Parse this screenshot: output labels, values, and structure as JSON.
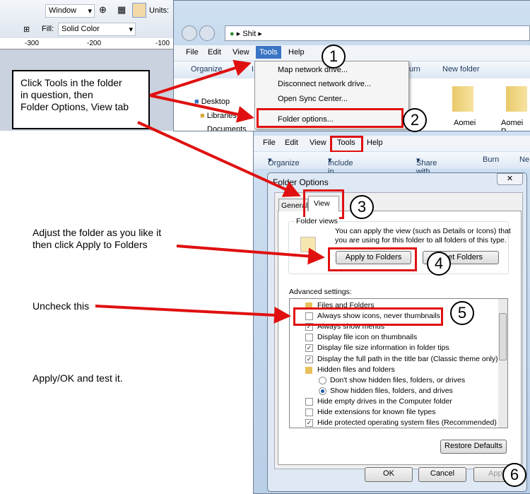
{
  "paint_toolbar": {
    "zoom_select": "Window",
    "units_label": "Units:",
    "fill_label": "Fill:",
    "fill_select": "Solid Color",
    "ruler_ticks": [
      "-300",
      "-200",
      "-100"
    ]
  },
  "explorer_top": {
    "address": "Shit",
    "menu": [
      "File",
      "Edit",
      "View",
      "Tools",
      "Help"
    ],
    "toolbar": [
      "Organize",
      "I",
      "urn",
      "New folder"
    ],
    "nav": [
      "Desktop",
      "Libraries",
      "Documents"
    ],
    "folders": [
      "Aomei",
      "Aomei P"
    ],
    "tools_menu": [
      "Map network drive...",
      "Disconnect network drive...",
      "Open Sync Center...",
      "Folder options..."
    ]
  },
  "explorer_bottom": {
    "menu": [
      "File",
      "Edit",
      "View",
      "Tools",
      "Help"
    ],
    "toolbar": [
      "Organize",
      "Include in library",
      "Share with",
      "Burn",
      "Ne"
    ]
  },
  "dialog": {
    "title": "Folder Options",
    "tabs": [
      "General",
      "View"
    ],
    "folder_views_label": "Folder views",
    "folder_views_text": [
      "You can apply the view (such as Details or Icons) that",
      "you are using for this folder to all folders of this type."
    ],
    "apply_button": "Apply to Folders",
    "reset_button": "Reset Folders",
    "advanced_label": "Advanced settings:",
    "settings": [
      {
        "label": "Files and Folders",
        "type": "folder"
      },
      {
        "label": "Always show icons, never thumbnails",
        "type": "checkbox",
        "checked": false
      },
      {
        "label": "Always show menus",
        "type": "checkbox",
        "checked": true
      },
      {
        "label": "Display file icon on thumbnails",
        "type": "checkbox",
        "checked": false
      },
      {
        "label": "Display file size information in folder tips",
        "type": "checkbox",
        "checked": true
      },
      {
        "label": "Display the full path in the title bar (Classic theme only)",
        "type": "checkbox",
        "checked": true
      },
      {
        "label": "Hidden files and folders",
        "type": "folder"
      },
      {
        "label": "Don't show hidden files, folders, or drives",
        "type": "radio",
        "checked": false
      },
      {
        "label": "Show hidden files, folders, and drives",
        "type": "radio",
        "checked": true
      },
      {
        "label": "Hide empty drives in the Computer folder",
        "type": "checkbox",
        "checked": false
      },
      {
        "label": "Hide extensions for known file types",
        "type": "checkbox",
        "checked": false
      },
      {
        "label": "Hide protected operating system files (Recommended)",
        "type": "checkbox",
        "checked": true
      }
    ],
    "restore_button": "Restore Defaults",
    "ok_button": "OK",
    "cancel_button": "Cancel",
    "apply_footer_button": "Apply"
  },
  "annotations": {
    "callout": [
      "Click Tools in the folder",
      "in question, then",
      "Folder Options, View tab"
    ],
    "adjust": [
      "Adjust the folder as you like it",
      "then click Apply to Folders"
    ],
    "uncheck": "Uncheck this",
    "apply_ok": "Apply/OK and test it.",
    "steps": [
      "1",
      "2",
      "3",
      "4",
      "5",
      "6"
    ],
    "color": "#e01010"
  }
}
